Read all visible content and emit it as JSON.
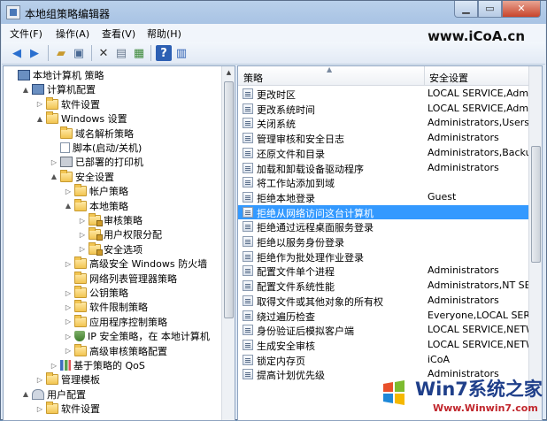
{
  "window": {
    "title": "本地组策略编辑器"
  },
  "controls": {
    "minimize": "▁",
    "maximize": "▭",
    "close": "✕"
  },
  "menu": {
    "items": [
      "文件(F)",
      "操作(A)",
      "查看(V)",
      "帮助(H)"
    ]
  },
  "watermark": "www.iCoA.cn",
  "toolbar": {
    "icons": [
      "back-icon",
      "forward-icon",
      "up-folder-icon",
      "show-hide-tree-icon",
      "delete-icon",
      "properties-icon",
      "export-list-icon",
      "help-icon",
      "help-topics-icon"
    ]
  },
  "tree": {
    "items": [
      {
        "label": "本地计算机 策略",
        "level": 0,
        "icon": "computer",
        "exp": ""
      },
      {
        "label": "计算机配置",
        "level": 1,
        "icon": "computer",
        "exp": "▲"
      },
      {
        "label": "软件设置",
        "level": 2,
        "icon": "folder",
        "exp": "▷"
      },
      {
        "label": "Windows 设置",
        "level": 2,
        "icon": "folder",
        "exp": "▲"
      },
      {
        "label": "域名解析策略",
        "level": 3,
        "icon": "folder",
        "exp": ""
      },
      {
        "label": "脚本(启动/关机)",
        "level": 3,
        "icon": "doc",
        "exp": ""
      },
      {
        "label": "已部署的打印机",
        "level": 3,
        "icon": "printer",
        "exp": "▷"
      },
      {
        "label": "安全设置",
        "level": 3,
        "icon": "folder",
        "exp": "▲"
      },
      {
        "label": "帐户策略",
        "level": 4,
        "icon": "folder",
        "exp": "▷"
      },
      {
        "label": "本地策略",
        "level": 4,
        "icon": "folder",
        "exp": "▲"
      },
      {
        "label": "审核策略",
        "level": 5,
        "icon": "lockfolder",
        "exp": "▷"
      },
      {
        "label": "用户权限分配",
        "level": 5,
        "icon": "lockfolder",
        "exp": "▷"
      },
      {
        "label": "安全选项",
        "level": 5,
        "icon": "lockfolder",
        "exp": "▷"
      },
      {
        "label": "高级安全 Windows 防火墙",
        "level": 4,
        "icon": "folder",
        "exp": "▷"
      },
      {
        "label": "网络列表管理器策略",
        "level": 4,
        "icon": "folder",
        "exp": ""
      },
      {
        "label": "公钥策略",
        "level": 4,
        "icon": "folder",
        "exp": "▷"
      },
      {
        "label": "软件限制策略",
        "level": 4,
        "icon": "folder",
        "exp": "▷"
      },
      {
        "label": "应用程序控制策略",
        "level": 4,
        "icon": "folder",
        "exp": "▷"
      },
      {
        "label": "IP 安全策略，在 本地计算机",
        "level": 4,
        "icon": "shield",
        "exp": "▷"
      },
      {
        "label": "高级审核策略配置",
        "level": 4,
        "icon": "folder",
        "exp": "▷"
      },
      {
        "label": "基于策略的 QoS",
        "level": 3,
        "icon": "chart",
        "exp": "▷"
      },
      {
        "label": "管理模板",
        "level": 2,
        "icon": "folder",
        "exp": "▷"
      },
      {
        "label": "用户配置",
        "level": 1,
        "icon": "users",
        "exp": "▲"
      },
      {
        "label": "软件设置",
        "level": 2,
        "icon": "folder",
        "exp": "▷"
      }
    ]
  },
  "list": {
    "columns": [
      "策略",
      "安全设置"
    ],
    "rows": [
      {
        "policy": "更改时区",
        "setting": "LOCAL SERVICE,Admini..."
      },
      {
        "policy": "更改系统时间",
        "setting": "LOCAL SERVICE,Admini..."
      },
      {
        "policy": "关闭系统",
        "setting": "Administrators,Users,Ba..."
      },
      {
        "policy": "管理审核和安全日志",
        "setting": "Administrators"
      },
      {
        "policy": "还原文件和目录",
        "setting": "Administrators,Backup ..."
      },
      {
        "policy": "加载和卸载设备驱动程序",
        "setting": "Administrators"
      },
      {
        "policy": "将工作站添加到域",
        "setting": ""
      },
      {
        "policy": "拒绝本地登录",
        "setting": "Guest"
      },
      {
        "policy": "拒绝从网络访问这台计算机",
        "setting": ""
      },
      {
        "policy": "拒绝通过远程桌面服务登录",
        "setting": ""
      },
      {
        "policy": "拒绝以服务身份登录",
        "setting": ""
      },
      {
        "policy": "拒绝作为批处理作业登录",
        "setting": ""
      },
      {
        "policy": "配置文件单个进程",
        "setting": "Administrators"
      },
      {
        "policy": "配置文件系统性能",
        "setting": "Administrators,NT SERVI..."
      },
      {
        "policy": "取得文件或其他对象的所有权",
        "setting": "Administrators"
      },
      {
        "policy": "绕过遍历检查",
        "setting": "Everyone,LOCAL SERVICE..."
      },
      {
        "policy": "身份验证后模拟客户端",
        "setting": "LOCAL SERVICE,NETWO..."
      },
      {
        "policy": "生成安全审核",
        "setting": "LOCAL SERVICE,NETWO..."
      },
      {
        "policy": "锁定内存页",
        "setting": "iCoA"
      },
      {
        "policy": "提高计划优先级",
        "setting": "Administrators"
      }
    ],
    "selected_index": 8
  },
  "badge": {
    "title": "Win7系统之家",
    "url": "Www.Winwin7.com"
  }
}
